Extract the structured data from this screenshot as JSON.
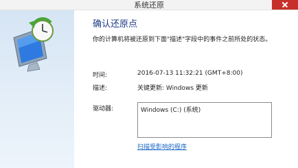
{
  "window": {
    "title": "系统还原"
  },
  "sidebar": {
    "icon": "system-restore-icon"
  },
  "main": {
    "heading": "确认还原点",
    "description": "你的计算机将被还原到下面\"描述\"字段中的事件之前所处的状态。",
    "time_label": "时间:",
    "time_value": "2016-07-13 11:32:21 (GMT+8:00)",
    "desc_label": "描述:",
    "desc_value": "关键更新: Windows 更新",
    "drives_label": "驱动器:",
    "drives": [
      "Windows (C:) (系统)"
    ],
    "scan_link": "扫描受影响的程序"
  },
  "colors": {
    "heading": "#1f3b88",
    "link": "#1a66c4",
    "close_button": "#c7302a",
    "sidebar": "#d6e5f4"
  }
}
